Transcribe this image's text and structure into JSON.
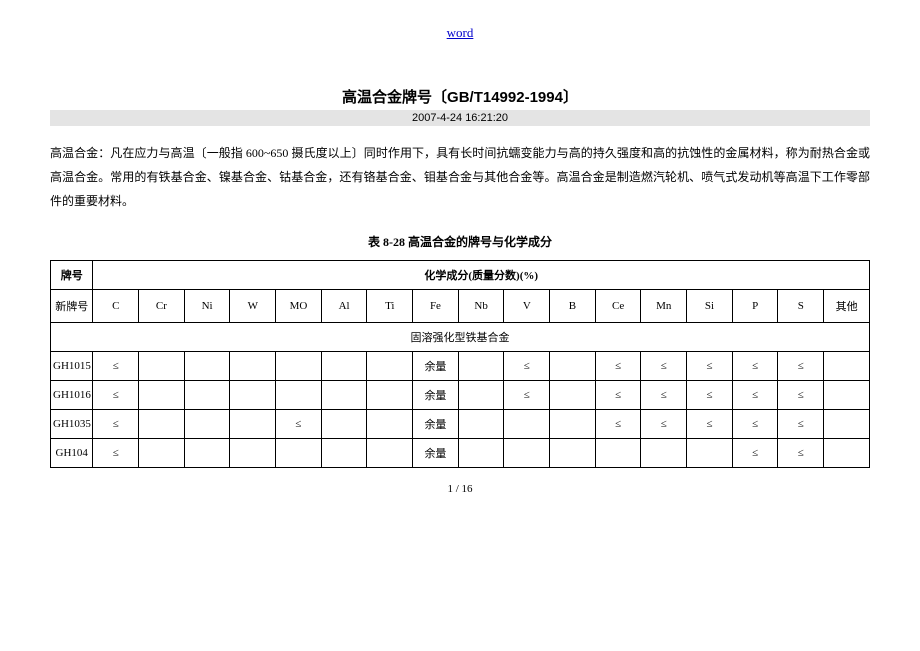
{
  "header_link": "word",
  "title": "高温合金牌号〔GB/T14992-1994〕",
  "timestamp": "2007-4-24 16:21:20",
  "intro": "高温合金：凡在应力与高温〔一般指 600~650 摄氏度以上〕同时作用下，具有长时间抗蠕变能力与高的持久强度和高的抗蚀性的金属材料，称为耐热合金或高温合金。常用的有铁基合金、镍基合金、钴基合金，还有铬基合金、钼基合金与其他合金等。高温合金是制造燃汽轮机、喷气式发动机等高温下工作零部件的重要材料。",
  "table_caption": "表 8-28 高温合金的牌号与化学成分",
  "headers": {
    "grade": "牌号",
    "chem": "化学成分(质量分数)(%)",
    "new_grade": "新牌号",
    "elements": [
      "C",
      "Cr",
      "Ni",
      "W",
      "MO",
      "Al",
      "Ti",
      "Fe",
      "Nb",
      "V",
      "B",
      "Ce",
      "Mn",
      "Si",
      "P",
      "S",
      "其他"
    ]
  },
  "section_row": "固溶强化型铁基合金",
  "rows": [
    {
      "grade": "GH1015",
      "c": "≤",
      "cr": "",
      "ni": "",
      "w": "",
      "mo": "",
      "al": "",
      "ti": "",
      "fe": "余量",
      "nb": "",
      "v": "≤",
      "b": "",
      "ce": "≤",
      "mn": "≤",
      "si": "≤",
      "p": "≤",
      "s": "≤",
      "other": ""
    },
    {
      "grade": "GH1016",
      "c": "≤",
      "cr": "",
      "ni": "",
      "w": "",
      "mo": "",
      "al": "",
      "ti": "",
      "fe": "余量",
      "nb": "",
      "v": "≤",
      "b": "",
      "ce": "≤",
      "mn": "≤",
      "si": "≤",
      "p": "≤",
      "s": "≤",
      "other": ""
    },
    {
      "grade": "GH1035",
      "c": "≤",
      "cr": "",
      "ni": "",
      "w": "",
      "mo": "≤",
      "al": "",
      "ti": "",
      "fe": "余量",
      "nb": "",
      "v": "",
      "b": "",
      "ce": "≤",
      "mn": "≤",
      "si": "≤",
      "p": "≤",
      "s": "≤",
      "other": ""
    },
    {
      "grade": "GH104",
      "c": "≤",
      "cr": "",
      "ni": "",
      "w": "",
      "mo": "",
      "al": "",
      "ti": "",
      "fe": "余量",
      "nb": "",
      "v": "",
      "b": "",
      "ce": "",
      "mn": "",
      "si": "",
      "p": "≤",
      "s": "≤",
      "other": ""
    }
  ],
  "page_number": "1 / 16"
}
